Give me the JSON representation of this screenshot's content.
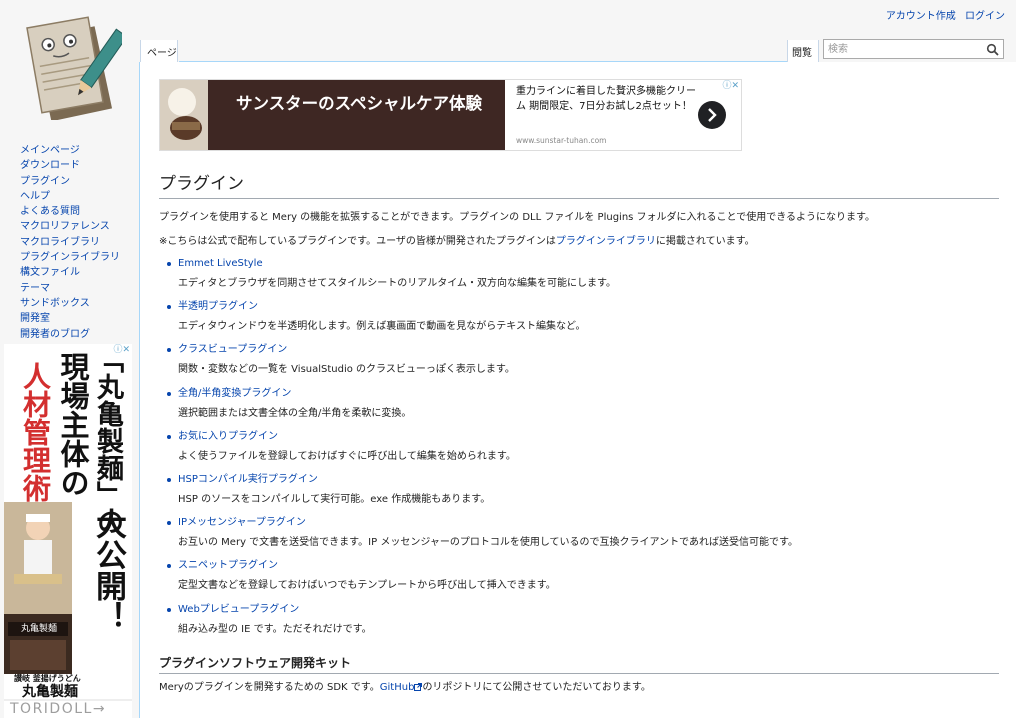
{
  "personal": {
    "create_account": "アカウント作成",
    "login": "ログイン"
  },
  "tabs": {
    "page": "ページ",
    "view": "閲覧"
  },
  "search": {
    "placeholder": "検索"
  },
  "nav": [
    "メインページ",
    "ダウンロード",
    "プラグイン",
    "ヘルプ",
    "よくある質問",
    "マクロリファレンス",
    "マクロライブラリ",
    "プラグインライブラリ",
    "構文ファイル",
    "テーマ",
    "サンドボックス",
    "開発室",
    "開発者のブログ"
  ],
  "ad_left": {
    "col1": "「丸亀製麺」の",
    "col2": "現場主体の",
    "col3": "人材管理術",
    "col4": "大公開！",
    "shop_sign": "丸亀製麺",
    "brand_tag": "讃岐 釜揚げうどん",
    "brand": "丸亀製麺",
    "footer": "TORIDOLL→"
  },
  "ad_top": {
    "headline": "サンスターのスペシャルケア体験",
    "description": "重力ラインに着目した贅沢多機能クリーム 期間限定、7日分お試し2点セット！",
    "url": "www.sunstar-tuhan.com"
  },
  "page": {
    "title": "プラグイン",
    "intro": "プラグインを使用すると Mery の機能を拡張することができます。プラグインの DLL ファイルを Plugins フォルダに入れることで使用できるようになります。",
    "note_pre": "※こちらは公式で配布しているプラグインです。ユーザの皆様が開発されたプラグインは",
    "note_link": "プラグインライブラリ",
    "note_post": "に掲載されています。",
    "plugins": [
      {
        "name": "Emmet LiveStyle",
        "desc": "エディタとブラウザを同期させてスタイルシートのリアルタイム・双方向な編集を可能にします。"
      },
      {
        "name": "半透明プラグイン",
        "desc": "エディタウィンドウを半透明化します。例えば裏画面で動画を見ながらテキスト編集など。"
      },
      {
        "name": "クラスビュープラグイン",
        "desc": "関数・変数などの一覧を VisualStudio のクラスビューっぽく表示します。"
      },
      {
        "name": "全角/半角変換プラグイン",
        "desc": "選択範囲または文書全体の全角/半角を柔軟に変換。"
      },
      {
        "name": "お気に入りプラグイン",
        "desc": "よく使うファイルを登録しておけばすぐに呼び出して編集を始められます。"
      },
      {
        "name": "HSPコンパイル実行プラグイン",
        "desc": "HSP のソースをコンパイルして実行可能。exe 作成機能もあります。"
      },
      {
        "name": "IPメッセンジャープラグイン",
        "desc": "お互いの Mery で文書を送受信できます。IP メッセンジャーのプロトコルを使用しているので互換クライアントであれば送受信可能です。"
      },
      {
        "name": "スニペットプラグイン",
        "desc": "定型文書などを登録しておけばいつでもテンプレートから呼び出して挿入できます。"
      },
      {
        "name": "Webプレビュープラグイン",
        "desc": "組み込み型の IE です。ただそれだけです。"
      }
    ],
    "sdk_heading": "プラグインソフトウェア開発キット",
    "sdk_pre": "Meryのプラグインを開発するための SDK です。",
    "sdk_link": "GitHub",
    "sdk_post": "のリポジトリにて公開させていただいております。"
  },
  "colors": {
    "link": "#0645ad",
    "border": "#a7d7f9",
    "ad_dark": "#3e2723",
    "ad_red": "#d32f2f"
  }
}
